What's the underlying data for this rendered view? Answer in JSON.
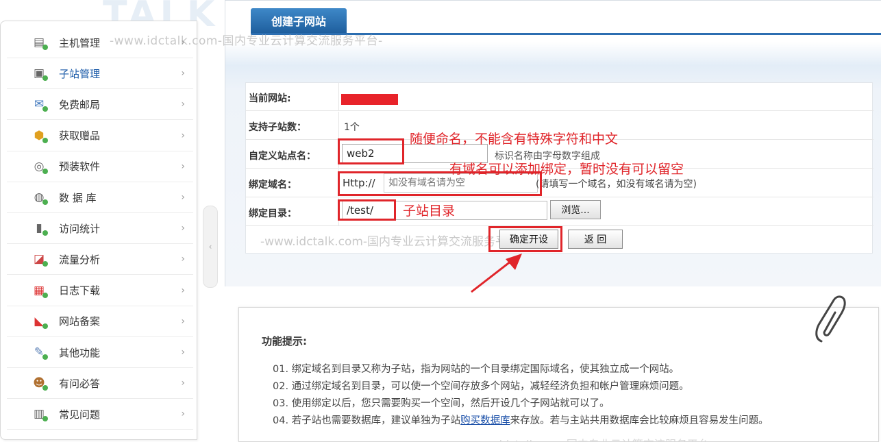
{
  "watermark": {
    "brand_top": "TALK 云说",
    "slogan": "-www.idctalk.com-国内专业云计算交流服务平台-"
  },
  "sidebar": {
    "items": [
      {
        "label": "主机管理",
        "icon": "server-icon"
      },
      {
        "label": "子站管理",
        "icon": "subsite-icon",
        "active": true
      },
      {
        "label": "免费邮局",
        "icon": "mail-icon"
      },
      {
        "label": "获取赠品",
        "icon": "gift-icon"
      },
      {
        "label": "预装软件",
        "icon": "software-icon"
      },
      {
        "label": "数 据 库",
        "icon": "database-icon"
      },
      {
        "label": "访问统计",
        "icon": "stats-icon"
      },
      {
        "label": "流量分析",
        "icon": "traffic-icon"
      },
      {
        "label": "日志下载",
        "icon": "calendar-icon"
      },
      {
        "label": "网站备案",
        "icon": "record-icon"
      },
      {
        "label": "其他功能",
        "icon": "wrench-icon"
      },
      {
        "label": "有问必答",
        "icon": "user-help-icon"
      },
      {
        "label": "常见问题",
        "icon": "faq-icon"
      }
    ],
    "chevron": "›"
  },
  "header": {
    "tab_label": "创建子网站"
  },
  "form": {
    "current_site_label": "当前网站:",
    "subsite_count_label": "支持子站数：",
    "subsite_count_value": "1个",
    "site_name_label": "自定义站点名：",
    "site_name_value": "web2",
    "site_name_hint": "标识名称由字母数字组成",
    "domain_label": "绑定域名：",
    "domain_prefix": "Http://",
    "domain_placeholder": "如没有域名请为空",
    "domain_hint": "(请填写一个域名，如没有域名请为空)",
    "dir_label": "绑定目录：",
    "dir_value": "/test/",
    "browse_label": "浏览...",
    "confirm_label": "确定开设",
    "back_label": "返 回"
  },
  "annotations": {
    "name_note": "随便命名，不能含有特殊字符和中文",
    "domain_note": "有域名可以添加绑定，暂时没有可以留空",
    "dir_note": "子站目录",
    "color": "#e0252a"
  },
  "tips": {
    "title": "功能提示:",
    "lines": [
      "01.  绑定域名到目录又称为子站，指为网站的一个目录绑定国际域名，使其独立成一个网站。",
      "02.  通过绑定域名到目录，可以使一个空间存放多个网站，减轻经济负担和帐户管理麻烦问题。",
      "03.  使用绑定以后，您只需要购买一个空间，然后开设几个子网站就可以了。"
    ],
    "line4_prefix": "04.  若子站也需要数据库，建议单独为子站",
    "line4_link": "购买数据库",
    "line4_suffix": "来存放。若与主站共用数据库会比较麻烦且容易发生问题。"
  },
  "colors": {
    "accent_blue": "#2c6eb1",
    "link_blue": "#1a4fa8",
    "annotation_red": "#e0252a"
  }
}
